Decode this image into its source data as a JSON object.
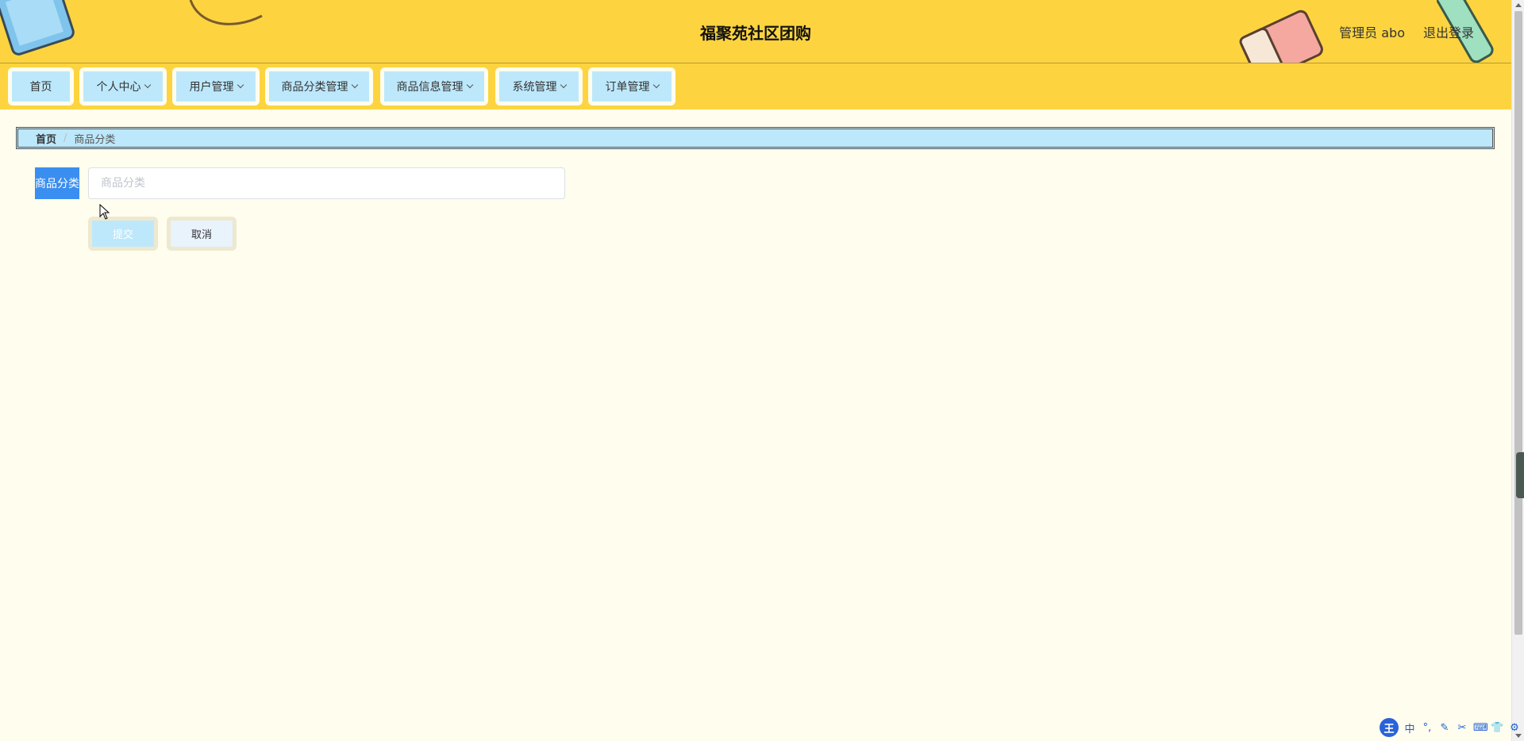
{
  "header": {
    "title": "福聚苑社区团购",
    "user_label": "管理员 abo",
    "logout_label": "退出登录"
  },
  "nav": {
    "items": [
      {
        "label": "首页"
      },
      {
        "label": "个人中心"
      },
      {
        "label": "用户管理"
      },
      {
        "label": "商品分类管理"
      },
      {
        "label": "商品信息管理"
      },
      {
        "label": "系统管理"
      },
      {
        "label": "订单管理"
      }
    ]
  },
  "breadcrumb": {
    "home": "首页",
    "separator": "/",
    "current": "商品分类"
  },
  "form": {
    "category_label": "商品分类",
    "category_placeholder": "商品分类",
    "category_value": "",
    "submit_label": "提交",
    "cancel_label": "取消"
  },
  "ime": {
    "logo": "王",
    "mode": "中",
    "icons": [
      "punctuation-icon",
      "pen-icon",
      "scissors-icon",
      "keyboard-icon",
      "skin-icon",
      "settings-icon"
    ]
  },
  "colors": {
    "header_bg": "#fdd43f",
    "page_bg": "#fffdee",
    "nav_item_bg": "#bde8fb",
    "label_bg": "#3a8ef0"
  }
}
